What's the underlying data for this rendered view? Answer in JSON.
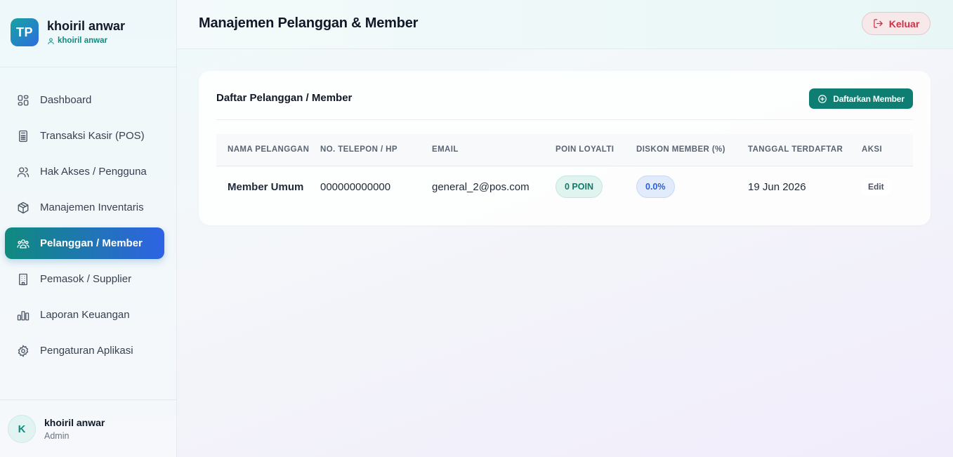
{
  "brand": {
    "logo_text": "TP",
    "name": "khoiril anwar",
    "sub": "khoiril anwar"
  },
  "nav": {
    "items": [
      {
        "label": "Dashboard",
        "icon": "dashboard-grid-icon"
      },
      {
        "label": "Transaksi Kasir (POS)",
        "icon": "calculator-icon"
      },
      {
        "label": "Hak Akses / Pengguna",
        "icon": "users-icon"
      },
      {
        "label": "Manajemen Inventaris",
        "icon": "box-icon"
      },
      {
        "label": "Pelanggan / Member",
        "icon": "group-icon",
        "active": true
      },
      {
        "label": "Pemasok / Supplier",
        "icon": "building-icon"
      },
      {
        "label": "Laporan Keuangan",
        "icon": "bar-chart-icon"
      },
      {
        "label": "Pengaturan Aplikasi",
        "icon": "gear-icon"
      }
    ]
  },
  "user": {
    "initial": "K",
    "name": "khoiril anwar",
    "role": "Admin"
  },
  "header": {
    "title": "Manajemen Pelanggan & Member",
    "logout_label": "Keluar"
  },
  "card": {
    "title": "Daftar Pelanggan / Member",
    "add_label": "Daftarkan Member",
    "columns": [
      "NAMA PELANGGAN",
      "NO. TELEPON / HP",
      "EMAIL",
      "POIN LOYALTI",
      "DISKON MEMBER (%)",
      "TANGGAL TERDAFTAR",
      "AKSI"
    ],
    "rows": [
      {
        "name": "Member Umum",
        "phone": "000000000000",
        "email": "general_2@pos.com",
        "points": "0 POIN",
        "discount": "0.0%",
        "date": "19 Jun 2026",
        "action": "Edit"
      }
    ]
  },
  "colors": {
    "accent": "#0f7e72",
    "active_gradient_start": "#0f8a7e",
    "active_gradient_end": "#2e63e4",
    "danger": "#d32f45"
  }
}
